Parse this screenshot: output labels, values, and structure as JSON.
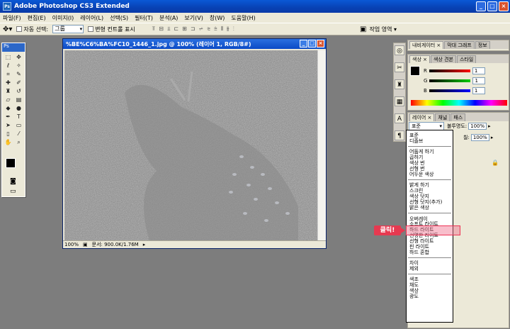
{
  "app": {
    "title": "Adobe Photoshop CS3 Extended",
    "logo": "Ps"
  },
  "window_controls": [
    "_",
    "□",
    "×"
  ],
  "menu": [
    "파일(F)",
    "편집(E)",
    "이미지(I)",
    "레이어(L)",
    "선택(S)",
    "필터(T)",
    "분석(A)",
    "보기(V)",
    "창(W)",
    "도움말(H)"
  ],
  "options": {
    "auto_select_label": "자동 선택:",
    "auto_select_value": "그룹",
    "show_transform_label": "변형 컨트롤 표시",
    "workspace_label": "작업 영역 ▾"
  },
  "document": {
    "title": "%BE%C6%BA%FC10_1446_1.jpg @ 100% (레이어 1, RGB/8#)",
    "zoom": "100%",
    "doc_size": "문서: 900.0K/1.76M"
  },
  "top_panel_tabs": [
    "내비게이터 ×",
    "막대 그래프",
    "정보"
  ],
  "color_panel": {
    "tabs": [
      "색상 ×",
      "색상 견본",
      "스타일"
    ],
    "sliders": [
      {
        "label": "R",
        "value": "1",
        "color": "#d02020"
      },
      {
        "label": "G",
        "value": "1",
        "color": "#20a020"
      },
      {
        "label": "B",
        "value": "1",
        "color": "#2040d0"
      }
    ]
  },
  "layers_panel": {
    "tabs": [
      "레이어 ×",
      "채널",
      "패스"
    ],
    "blend_value": "표준",
    "opacity_label": "불투명도:",
    "opacity_value": "100%",
    "fill_label": "칠:",
    "fill_value": "100%"
  },
  "blend_modes": [
    [
      "표준",
      "디졸브"
    ],
    [
      "어둡게 하기",
      "곱하기",
      "색상 번",
      "선형 번",
      "어두운 색상"
    ],
    [
      "밝게 하기",
      "스크린",
      "색상 닷지",
      "선형 닷지(추가)",
      "밝은 색상"
    ],
    [
      "오버레이",
      "소프트 라이트",
      "하드 라이트",
      "선명한 라이트",
      "선형 라이트",
      "핀 라이트",
      "하드 혼합"
    ],
    [
      "차이",
      "제외"
    ],
    [
      "색조",
      "채도",
      "색상",
      "광도"
    ]
  ],
  "highlighted_mode": "오버레이",
  "callout": "클릭!",
  "colors": {
    "accent": "#0a246a",
    "callout": "#e63950"
  }
}
